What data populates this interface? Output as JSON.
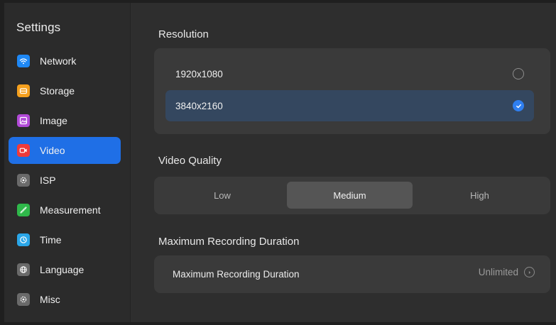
{
  "sidebar": {
    "title": "Settings",
    "items": [
      {
        "label": "Network",
        "icon": "wifi-icon",
        "color": "#1e88f5"
      },
      {
        "label": "Storage",
        "icon": "storage-icon",
        "color": "#f5a01e"
      },
      {
        "label": "Image",
        "icon": "image-icon",
        "color": "#b24ad8"
      },
      {
        "label": "Video",
        "icon": "video-camera-icon",
        "color": "#f03a3a",
        "active": true
      },
      {
        "label": "ISP",
        "icon": "gear-icon",
        "color": "#6a6a6a"
      },
      {
        "label": "Measurement",
        "icon": "ruler-icon",
        "color": "#2fb84a"
      },
      {
        "label": "Time",
        "icon": "clock-icon",
        "color": "#2aa6e8"
      },
      {
        "label": "Language",
        "icon": "globe-icon",
        "color": "#6a6a6a"
      },
      {
        "label": "Misc",
        "icon": "gear-icon",
        "color": "#6a6a6a"
      }
    ],
    "active_color": "#1f6fe6"
  },
  "resolution": {
    "title": "Resolution",
    "options": [
      {
        "label": "1920x1080",
        "selected": false
      },
      {
        "label": "3840x2160",
        "selected": true
      }
    ]
  },
  "video_quality": {
    "title": "Video Quality",
    "options": [
      "Low",
      "Medium",
      "High"
    ],
    "selected": "Medium"
  },
  "max_duration": {
    "section_title": "Maximum Recording Duration",
    "row_label": "Maximum Recording Duration",
    "value": "Unlimited",
    "value_icon": "chevron-right-circle-icon"
  }
}
